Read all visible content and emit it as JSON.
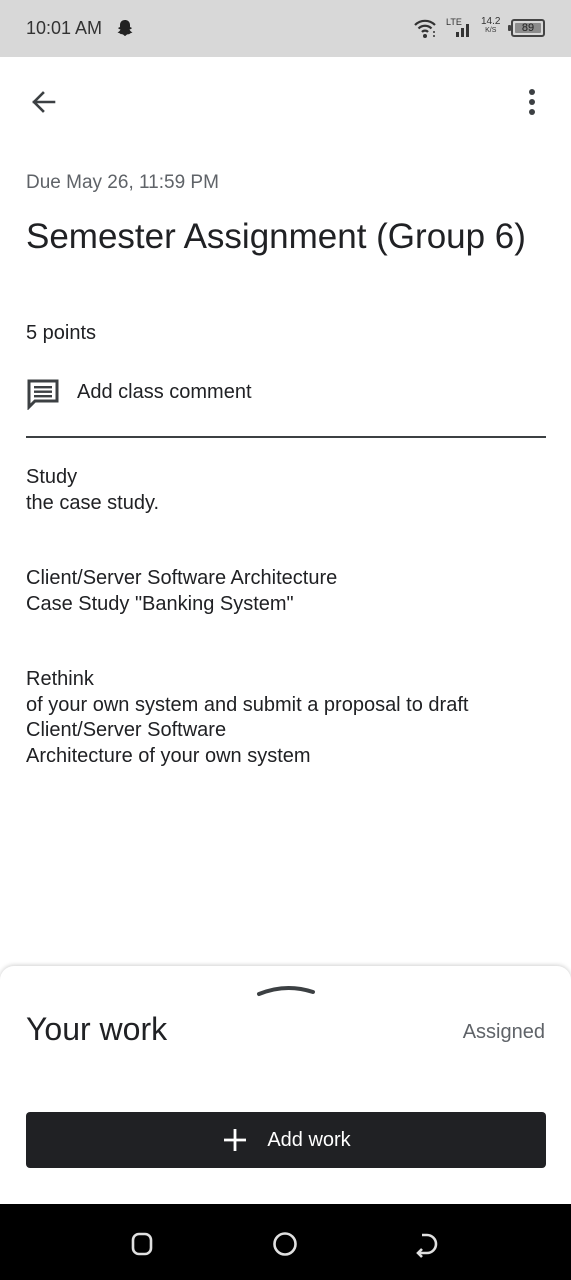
{
  "status_bar": {
    "time": "10:01 AM",
    "network": "LTE",
    "speed_value": "14.2",
    "speed_unit": "K/S",
    "battery": "89"
  },
  "toolbar": {
    "back_icon": "arrow-back-icon",
    "more_icon": "more-vert-icon"
  },
  "assignment": {
    "due": "Due May 26, 11:59 PM",
    "title": "Semester Assignment (Group 6)",
    "points": "5 points",
    "comment_label": "Add class comment",
    "description": [
      "Study\nthe case study.",
      "Client/Server Software Architecture\nCase Study \"Banking System\"",
      "Rethink\nof your own system and submit a proposal to draft\nClient/Server Software\nArchitecture of your own system"
    ]
  },
  "your_work": {
    "heading": "Your work",
    "status": "Assigned",
    "add_work_label": "Add work"
  }
}
